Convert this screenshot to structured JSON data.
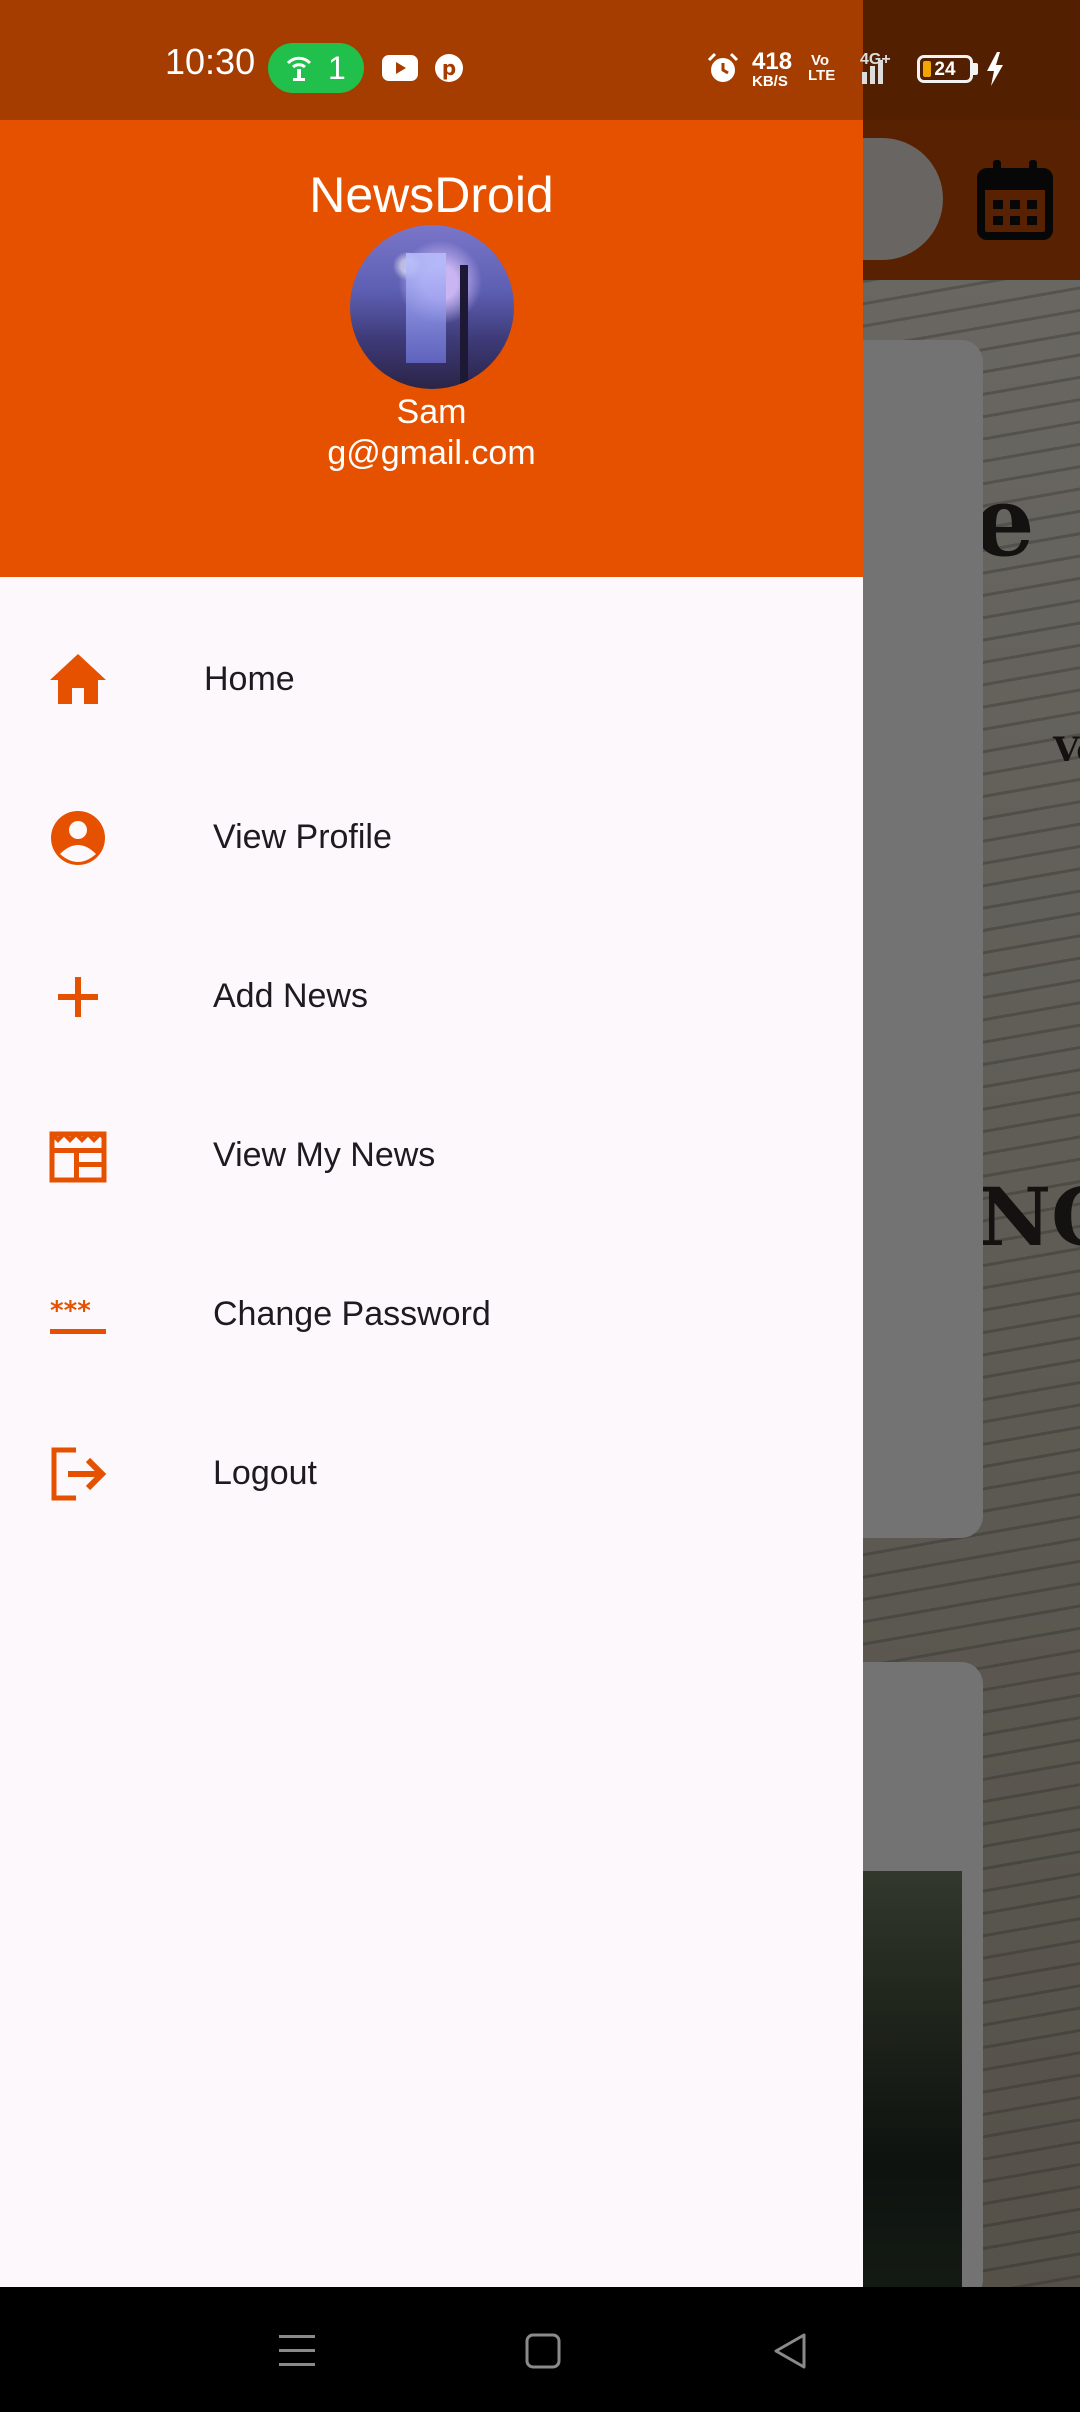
{
  "status_bar": {
    "time": "10:30",
    "hotspot_count": "1",
    "net_speed": "418",
    "net_speed_unit": "KB/S",
    "volte": "Vo LTE",
    "network_generation": "4G+",
    "battery_level": "24",
    "icons": [
      "hotspot-icon",
      "youtube-icon",
      "pinterest-icon",
      "alarm-icon",
      "signal-icon",
      "battery-icon",
      "charging-bolt-icon"
    ]
  },
  "drawer": {
    "app_title": "NewsDroid",
    "user": {
      "name": "Sam",
      "email": "g@gmail.com"
    },
    "items": [
      {
        "label": "Home",
        "icon": "home-icon"
      },
      {
        "label": "View Profile",
        "icon": "account-circle-icon"
      },
      {
        "label": "Add News",
        "icon": "add-icon"
      },
      {
        "label": "View My News",
        "icon": "newspaper-icon"
      },
      {
        "label": "Change Password",
        "icon": "password-icon"
      },
      {
        "label": "Logout",
        "icon": "logout-icon"
      }
    ]
  },
  "background_app": {
    "icons": [
      "calendar-icon"
    ],
    "newspaper_text": [
      "sle",
      "Vo",
      "NG"
    ]
  },
  "nav_bar": {
    "buttons": [
      "menu-icon",
      "home-square-icon",
      "back-triangle-icon"
    ]
  },
  "colors": {
    "accent": "#e65100",
    "status_bar": "#a63d00",
    "drawer_background": "#fcf8fc",
    "hotspot_pill": "#21c04c"
  }
}
